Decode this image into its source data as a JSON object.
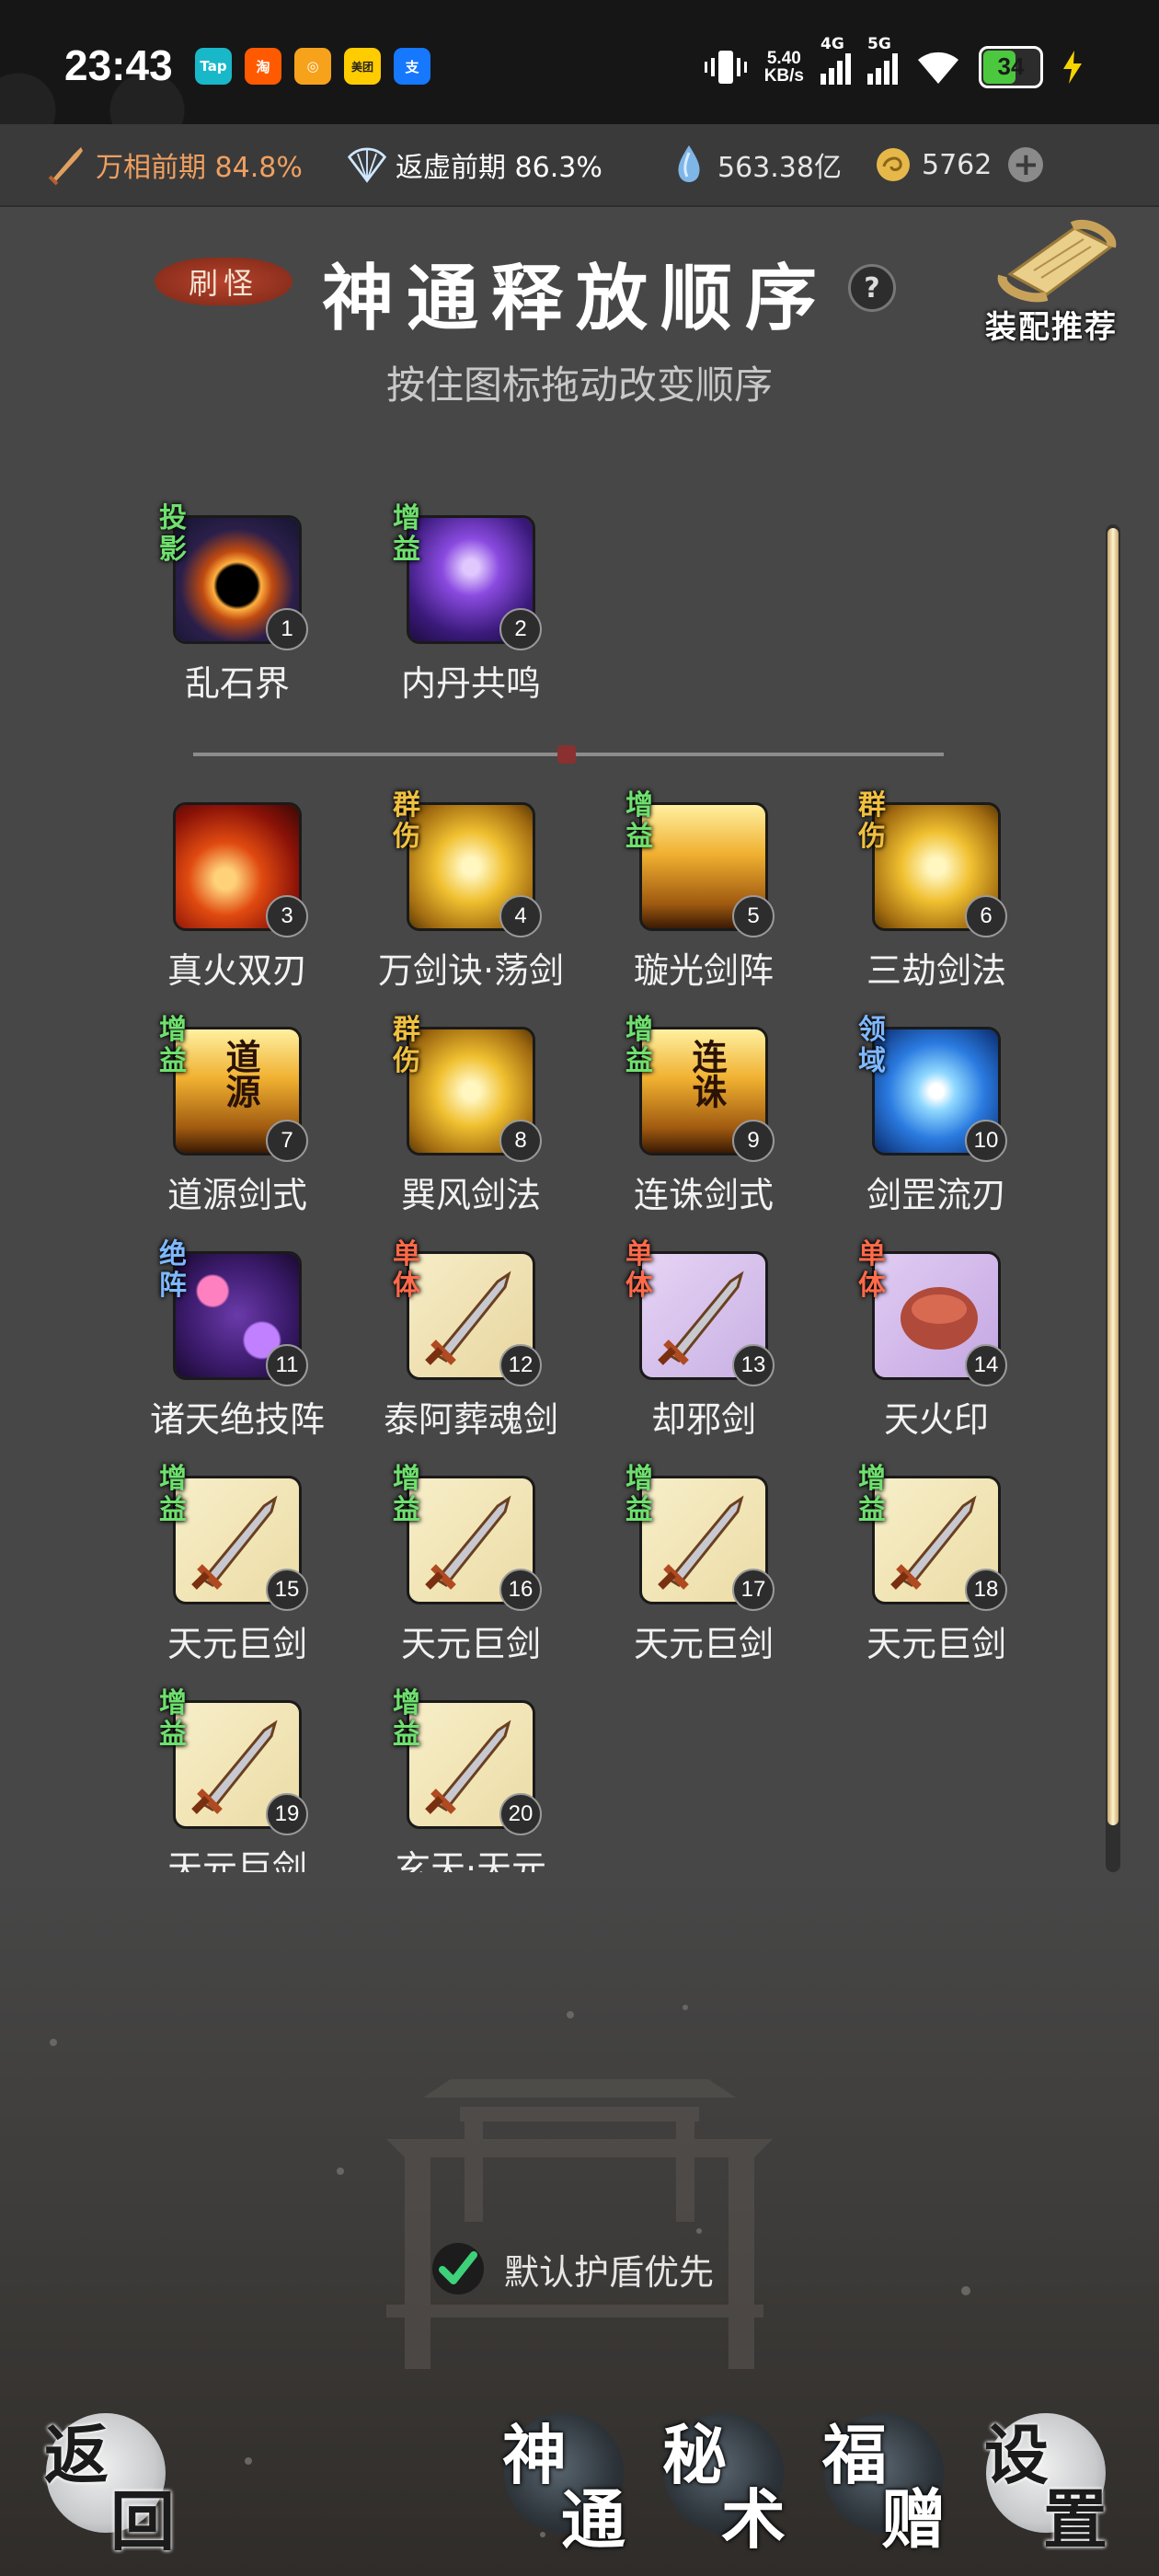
{
  "status_bar": {
    "time": "23:43",
    "apps": [
      {
        "label": "Tap",
        "color": "#19b8c9"
      },
      {
        "label": "淘",
        "color": "#ff5a00"
      },
      {
        "label": "◎",
        "color": "#f7a21b"
      },
      {
        "label": "美团",
        "color": "#ffcc00"
      },
      {
        "label": "支",
        "color": "#1677ff"
      }
    ],
    "net_speed_value": "5.40",
    "net_speed_unit": "KB/s",
    "sig1": "4G",
    "sig2": "5G",
    "battery": "34"
  },
  "resources": {
    "realm1": "万相前期 84.8%",
    "realm2": "返虚前期 86.3%",
    "spirit_stones": "563.38亿",
    "coins": "5762"
  },
  "header": {
    "tag": "刷怪",
    "title": "神通释放顺序",
    "help": "?",
    "subtitle": "按住图标拖动改变顺序",
    "recommend": "装配推荐"
  },
  "pinned": [
    {
      "num": "1",
      "name": "乱石界",
      "badge": "投影",
      "badge_color": "#6fe06f",
      "art": "blackhole"
    },
    {
      "num": "2",
      "name": "内丹共鸣",
      "badge": "增益",
      "badge_color": "#6fe06f",
      "art": "purple"
    }
  ],
  "skills": [
    {
      "num": "3",
      "name": "真火双刃",
      "badge": "",
      "badge_color": "#ffffff",
      "art": "fire"
    },
    {
      "num": "4",
      "name": "万剑诀·荡剑",
      "badge": "群伤",
      "badge_color": "#f0c040",
      "art": "gold"
    },
    {
      "num": "5",
      "name": "璇光剑阵",
      "badge": "增益",
      "badge_color": "#6fe06f",
      "art": "amber"
    },
    {
      "num": "6",
      "name": "三劫剑法",
      "badge": "群伤",
      "badge_color": "#f0c040",
      "art": "gold"
    },
    {
      "num": "7",
      "name": "道源剑式",
      "badge": "增益",
      "badge_color": "#6fe06f",
      "art": "amber",
      "glyph": "道源"
    },
    {
      "num": "8",
      "name": "巽风剑法",
      "badge": "群伤",
      "badge_color": "#f0c040",
      "art": "gold"
    },
    {
      "num": "9",
      "name": "连诛剑式",
      "badge": "增益",
      "badge_color": "#6fe06f",
      "art": "amber",
      "glyph": "连诛"
    },
    {
      "num": "10",
      "name": "剑罡流刃",
      "badge": "领域",
      "badge_color": "#7fb8ff",
      "art": "blue"
    },
    {
      "num": "11",
      "name": "诸天绝技阵",
      "badge": "绝阵",
      "badge_color": "#7fb8ff",
      "art": "galaxy"
    },
    {
      "num": "12",
      "name": "泰阿葬魂剑",
      "badge": "单体",
      "badge_color": "#ff6a4a",
      "art": "sword-cream"
    },
    {
      "num": "13",
      "name": "却邪剑",
      "badge": "单体",
      "badge_color": "#ff6a4a",
      "art": "sword-purple"
    },
    {
      "num": "14",
      "name": "天火印",
      "badge": "单体",
      "badge_color": "#ff6a4a",
      "art": "seal-purple"
    },
    {
      "num": "15",
      "name": "天元巨剑",
      "badge": "增益",
      "badge_color": "#6fe06f",
      "art": "dagger"
    },
    {
      "num": "16",
      "name": "天元巨剑",
      "badge": "增益",
      "badge_color": "#6fe06f",
      "art": "dagger"
    },
    {
      "num": "17",
      "name": "天元巨剑",
      "badge": "增益",
      "badge_color": "#6fe06f",
      "art": "dagger"
    },
    {
      "num": "18",
      "name": "天元巨剑",
      "badge": "增益",
      "badge_color": "#6fe06f",
      "art": "dagger"
    },
    {
      "num": "19",
      "name": "天元巨剑",
      "badge": "增益",
      "badge_color": "#6fe06f",
      "art": "dagger"
    },
    {
      "num": "20",
      "name": "玄天·天元",
      "badge": "增益",
      "badge_color": "#6fe06f",
      "art": "dagger"
    }
  ],
  "shield_option": {
    "label": "默认护盾优先",
    "checked": true
  },
  "nav": {
    "back": [
      "返",
      "回"
    ],
    "shentong": [
      "神",
      "通"
    ],
    "mishu": [
      "秘",
      "术"
    ],
    "fuzeng": [
      "福",
      "赠"
    ],
    "settings": [
      "设",
      "置"
    ]
  }
}
